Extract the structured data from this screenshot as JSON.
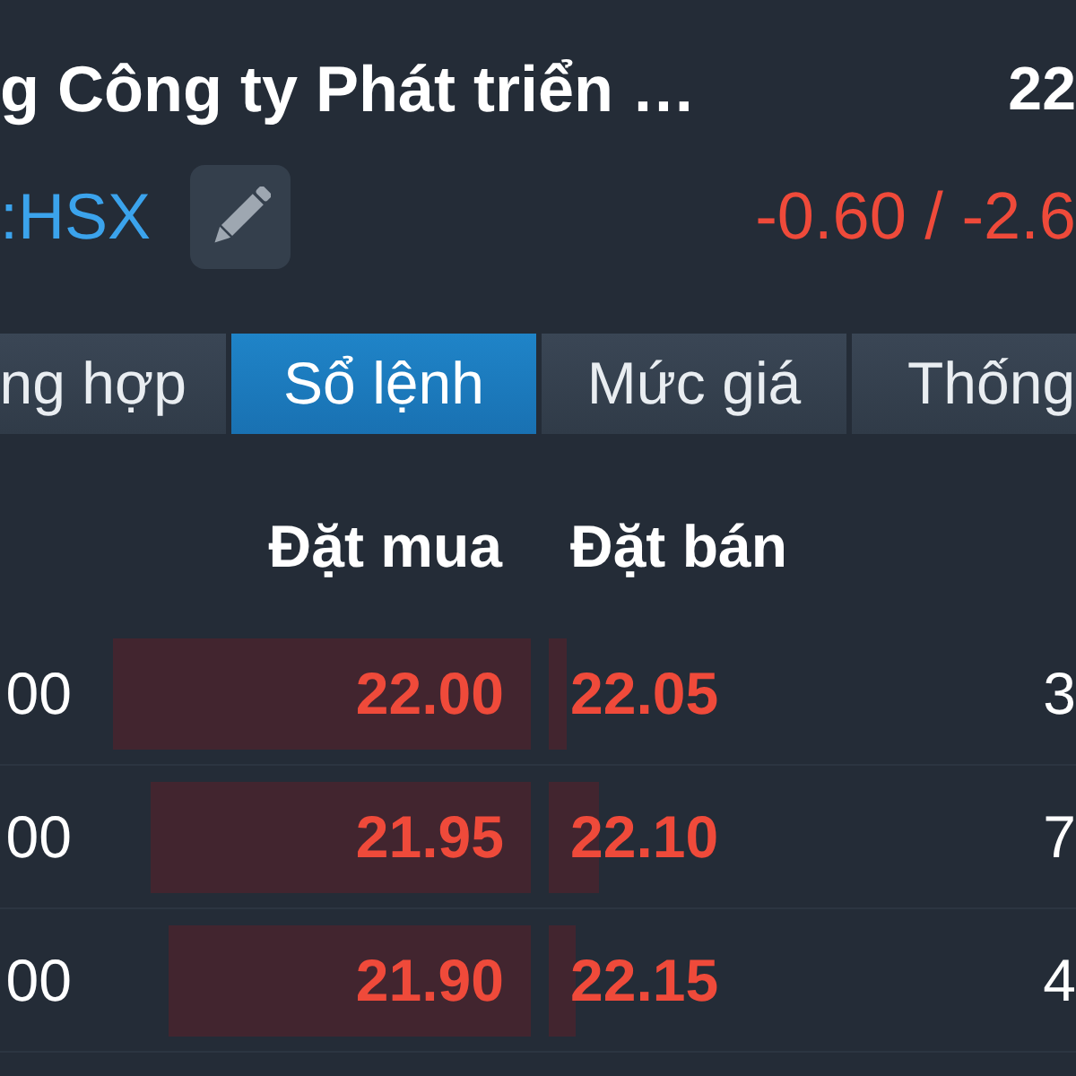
{
  "header": {
    "title": "g Công ty Phát triển …",
    "price": "22",
    "ticker": ":HSX",
    "change": "-0.60 / -2.6"
  },
  "tabs": [
    {
      "label": "ng hợp",
      "selected": false
    },
    {
      "label": "Sổ lệnh",
      "selected": true
    },
    {
      "label": "Mức giá",
      "selected": false
    },
    {
      "label": "Thống",
      "selected": false
    }
  ],
  "order_book": {
    "columns": [
      "Đặt mua",
      "Đặt bán"
    ],
    "rows": [
      {
        "bid": {
          "volume": "00",
          "price": "22.00",
          "level": 0.91
        },
        "ask": {
          "price": "22.05",
          "level": 0.04,
          "volume": "3"
        }
      },
      {
        "bid": {
          "volume": "00",
          "price": "21.95",
          "level": 0.83
        },
        "ask": {
          "price": "22.10",
          "level": 0.11,
          "volume": "7"
        }
      },
      {
        "bid": {
          "volume": "00",
          "price": "21.90",
          "level": 0.79
        },
        "ask": {
          "price": "22.15",
          "level": 0.06,
          "volume": "4"
        }
      }
    ]
  }
}
